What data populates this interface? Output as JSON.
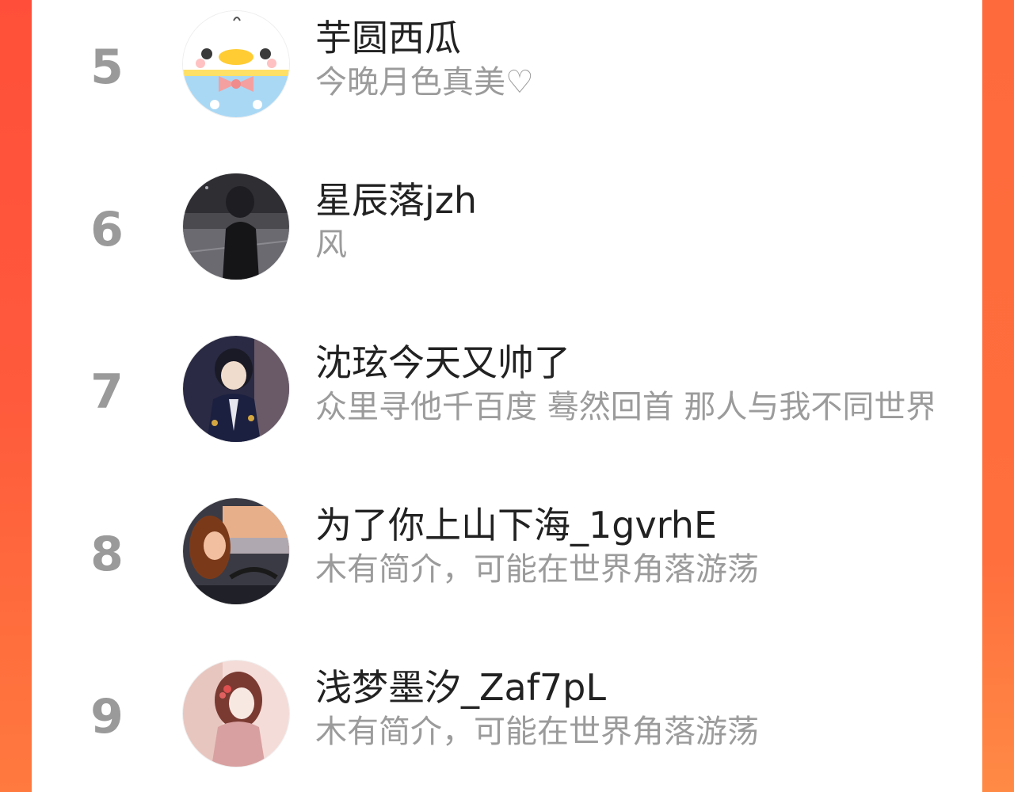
{
  "list": {
    "items": [
      {
        "rank": "5",
        "name": "芋圆西瓜",
        "bio": "今晚月色真美♡",
        "avatar": "duck-cartoon-avatar"
      },
      {
        "rank": "6",
        "name": "星辰落jzh",
        "bio": "风",
        "avatar": "girl-street-photo-avatar"
      },
      {
        "rank": "7",
        "name": "沈玹今天又帅了",
        "bio": "众里寻他千百度 蓦然回首 那人与我不同世界",
        "avatar": "anime-man-avatar"
      },
      {
        "rank": "8",
        "name": "为了你上山下海_1gvrhE",
        "bio": "木有简介，可能在世界角落游荡",
        "avatar": "girl-in-car-avatar"
      },
      {
        "rank": "9",
        "name": "浅梦墨汐_Zaf7pL",
        "bio": "木有简介，可能在世界角落游荡",
        "avatar": "anime-girl-illustration-avatar"
      }
    ]
  }
}
